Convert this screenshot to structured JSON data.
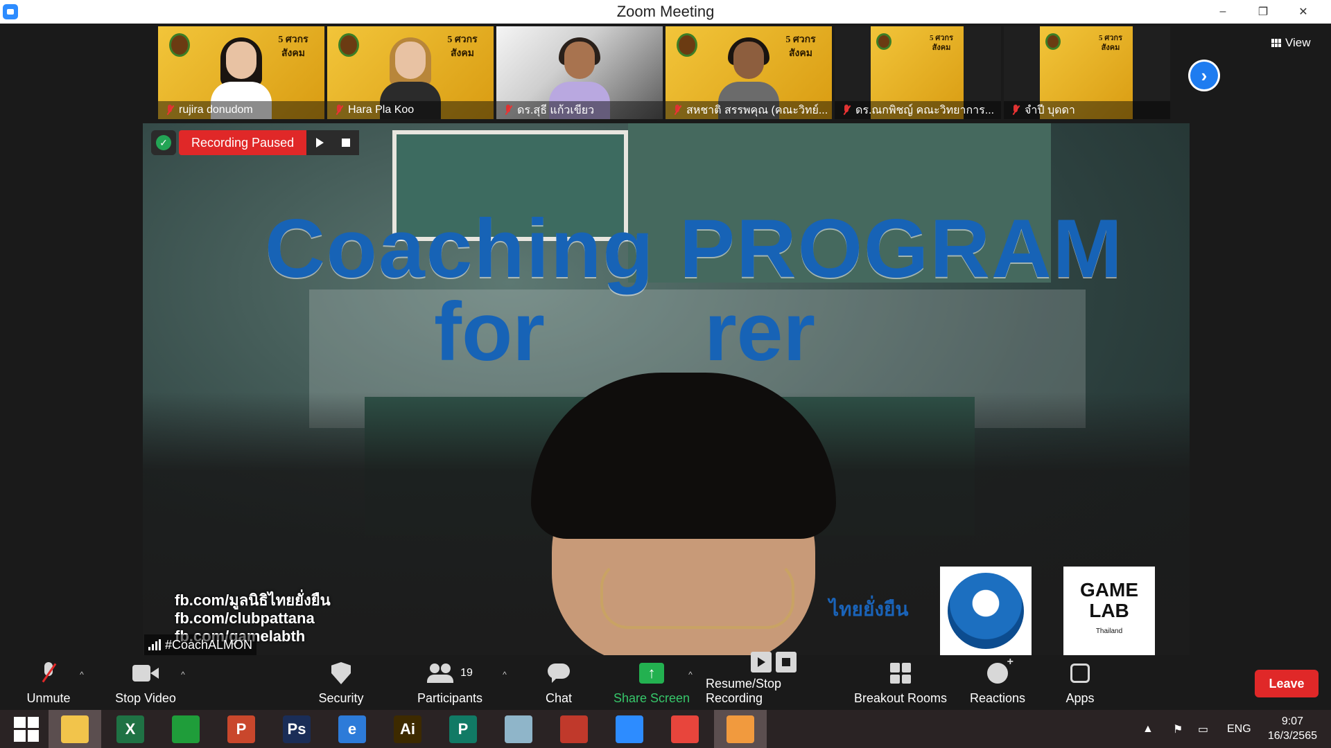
{
  "window": {
    "title": "Zoom Meeting",
    "controls": {
      "minimize": "–",
      "maximize": "❐",
      "close": "✕"
    }
  },
  "gallery": {
    "participants": [
      {
        "name": "rujira donudom"
      },
      {
        "name": "Hara Pla Koo"
      },
      {
        "name": "ดร.สุธี  แก้วเขียว"
      },
      {
        "name": "สหชาติ สรรพคุณ (คณะวิทย์..."
      },
      {
        "name": "ดร.ณกพิชญ์ คณะวิทยาการ..."
      },
      {
        "name": "จำปี บุดดา"
      }
    ],
    "banner_text": "5 ศวกร สังคม",
    "next_arrow": "›",
    "view_label": "View"
  },
  "recording": {
    "status": "Recording Paused"
  },
  "main_video": {
    "title_line1": "Coaching PROGRAM",
    "title_line2": "for",
    "title_line2_end": "rer",
    "links": [
      "fb.com/มูลนิธิไทยยั่งยืน",
      "fb.com/clubpattana",
      "fb.com/gamelabth"
    ],
    "speaker_name": "#CoachALMON",
    "logo_right_line1": "GAME",
    "logo_right_line2": "LAB",
    "logo_right_line3": "Thailand",
    "logo_thai": "ไทยยั่งยืน"
  },
  "toolbar": {
    "unmute": "Unmute",
    "stop_video": "Stop Video",
    "security": "Security",
    "participants_count": "19",
    "participants": "Participants",
    "chat": "Chat",
    "share_screen": "Share Screen",
    "recording": "Resume/Stop Recording",
    "breakout_rooms": "Breakout Rooms",
    "reactions": "Reactions",
    "apps": "Apps",
    "leave": "Leave",
    "caret": "^"
  },
  "taskbar": {
    "apps": [
      {
        "name": "file-explorer",
        "color": "#f2c44b"
      },
      {
        "name": "excel",
        "label": "X",
        "color": "#1f7244"
      },
      {
        "name": "store",
        "color": "#1f9d3a"
      },
      {
        "name": "powerpoint",
        "label": "P",
        "color": "#c9472c"
      },
      {
        "name": "photoshop",
        "label": "Ps",
        "color": "#1a2d57"
      },
      {
        "name": "internet-explorer",
        "label": "e",
        "color": "#2d7bd9"
      },
      {
        "name": "illustrator",
        "label": "Ai",
        "color": "#3d2a00"
      },
      {
        "name": "publisher",
        "label": "P",
        "color": "#117a65"
      },
      {
        "name": "notes",
        "color": "#8fb5c9"
      },
      {
        "name": "photoscape",
        "color": "#c0392b"
      },
      {
        "name": "zoom",
        "color": "#2d8cff"
      },
      {
        "name": "chrome",
        "color": "#e8453c"
      },
      {
        "name": "image-viewer",
        "color": "#f19a3e"
      }
    ],
    "language": "ENG",
    "time": "9:07",
    "date": "16/3/2565"
  }
}
